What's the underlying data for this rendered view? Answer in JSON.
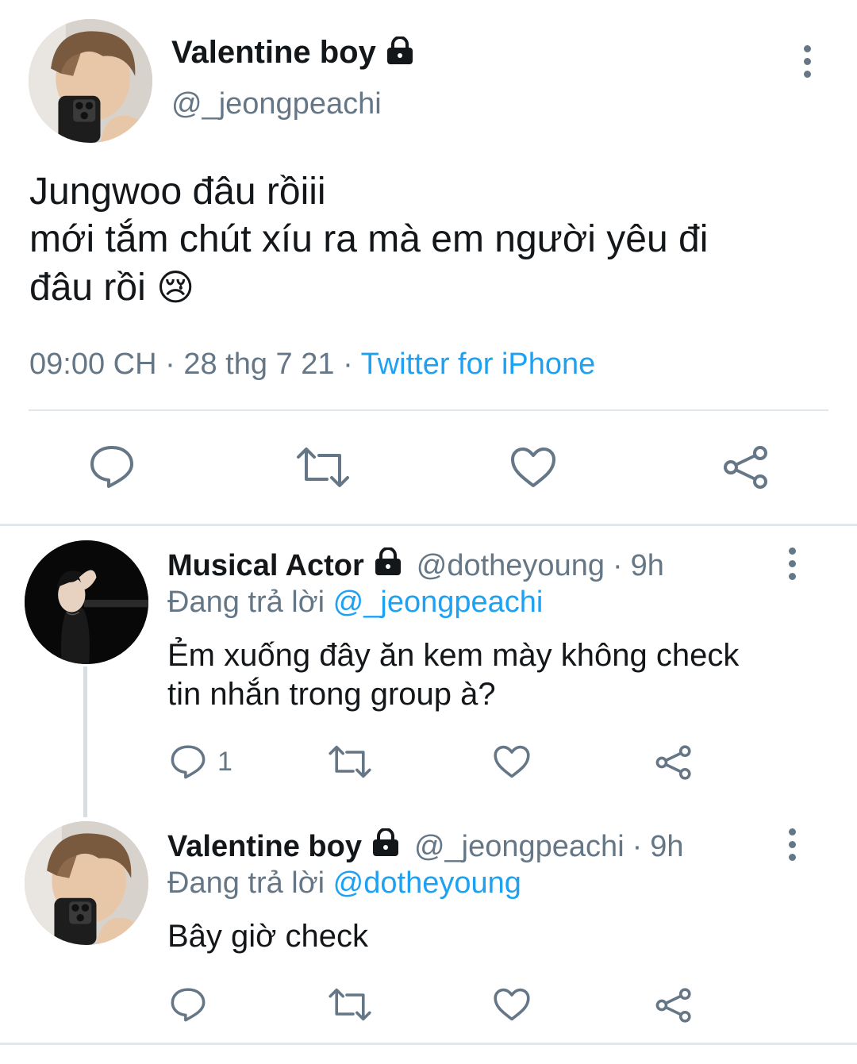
{
  "main_tweet": {
    "display_name": "Valentine boy",
    "handle": "@_jeongpeachi",
    "text_line1": "Jungwoo đâu rồiii",
    "text_line2": "mới tắm chút xíu ra mà em người yêu đi",
    "text_line3": "đâu rồi",
    "emoji": "😢",
    "time": "09:00 CH",
    "date": "28 thg 7 21",
    "source": "Twitter for iPhone",
    "separator": "·"
  },
  "replies": [
    {
      "display_name": "Musical Actor",
      "handle": "@dotheyoung",
      "age": "9h",
      "reply_prefix": "Đang trả lời",
      "reply_to": "@_jeongpeachi",
      "text_line1": "Ẻm xuống đây ăn kem mày không check",
      "text_line2": "tin nhắn trong group à?",
      "reply_count": "1"
    },
    {
      "display_name": "Valentine boy",
      "handle": "@_jeongpeachi",
      "age": "9h",
      "reply_prefix": "Đang trả lời",
      "reply_to": "@dotheyoung",
      "text_line1": "Bây giờ check"
    }
  ],
  "colors": {
    "text": "#14171a",
    "muted": "#657786",
    "link": "#1da1f2",
    "divider": "#e1e8ed"
  },
  "icons": [
    "lock-icon",
    "reply-icon",
    "retweet-icon",
    "like-icon",
    "share-icon",
    "more-icon"
  ]
}
